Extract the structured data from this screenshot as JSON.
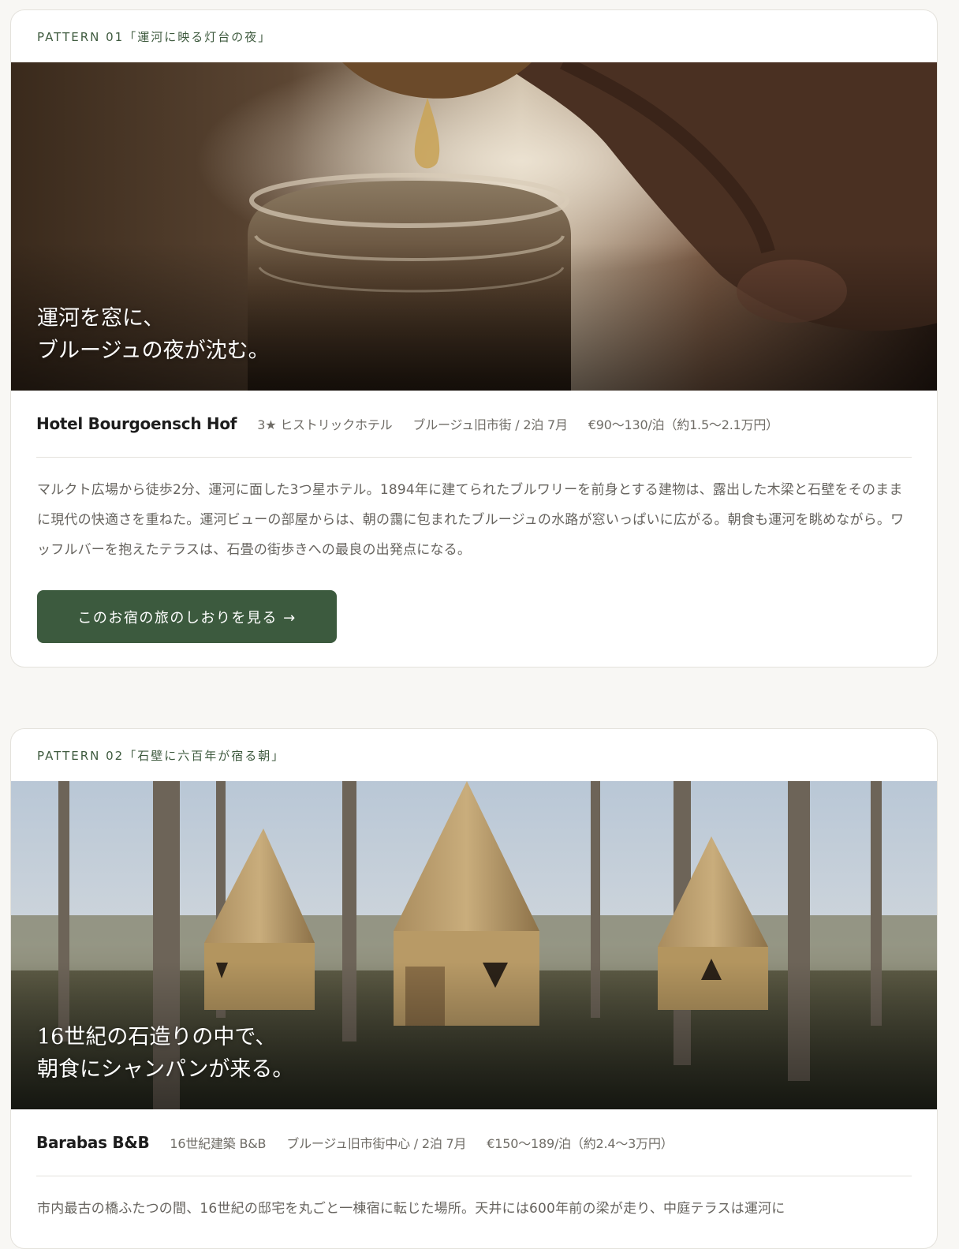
{
  "cards": [
    {
      "pattern_label": "PATTERN 01「運河に映る灯台の夜」",
      "hero_lines": [
        "運河を窓に、",
        "ブルージュの夜が沈む。"
      ],
      "hotel_name": "Hotel Bourgoensch Hof",
      "category": "3★ ヒストリックホテル",
      "location": "ブルージュ旧市街 / 2泊 7月",
      "price": "€90〜130/泊（約1.5〜2.1万円）",
      "description": "マルクト広場から徒歩2分、運河に面した3つ星ホテル。1894年に建てられたブルワリーを前身とする建物は、露出した木梁と石壁をそのままに現代の快適さを重ねた。運河ビューの部屋からは、朝の靄に包まれたブルージュの水路が窓いっぱいに広がる。朝食も運河を眺めながら。ワッフルバーを抱えたテラスは、石畳の街歩きへの最良の出発点になる。",
      "cta_label": "このお宿の旅のしおりを見る →"
    },
    {
      "pattern_label": "PATTERN 02「石壁に六百年が宿る朝」",
      "hero_lines": [
        "16世紀の石造りの中で、",
        "朝食にシャンパンが来る。"
      ],
      "hotel_name": "Barabas B&B",
      "category": "16世紀建築 B&B",
      "location": "ブルージュ旧市街中心 / 2泊 7月",
      "price": "€150〜189/泊（約2.4〜3万円）",
      "description": "市内最古の橋ふたつの間、16世紀の邸宅を丸ごと一棟宿に転じた場所。天井には600年前の梁が走り、中庭テラスは運河に"
    }
  ],
  "colors": {
    "accent_green": "#3c5a3e",
    "pattern_label": "#3e5a3e",
    "page_background": "#f8f7f4"
  },
  "icons": {
    "hero_1": "honey-jar-photo",
    "hero_2": "wooden-teepee-cabins-photo"
  }
}
